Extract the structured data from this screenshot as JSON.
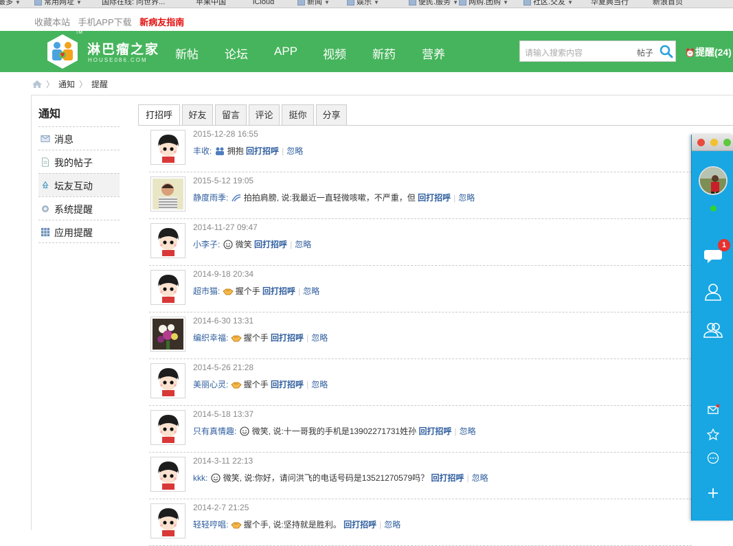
{
  "bookmarks": [
    {
      "label": "最多",
      "folder": false,
      "menu": true
    },
    {
      "label": "常用网址",
      "folder": true,
      "menu": true
    },
    {
      "label": "国际在线: 问世界...",
      "folder": false,
      "menu": false
    },
    {
      "label": "苹果中国",
      "folder": false,
      "menu": false
    },
    {
      "label": "iCloud",
      "folder": false,
      "menu": false
    },
    {
      "label": "新闻",
      "folder": true,
      "menu": true
    },
    {
      "label": "娱乐",
      "folder": true,
      "menu": true
    },
    {
      "label": "便民.服务",
      "folder": true,
      "menu": true
    },
    {
      "label": "网购.团购",
      "folder": true,
      "menu": true
    },
    {
      "label": "社区.交友",
      "folder": true,
      "menu": true
    },
    {
      "label": "华夏典当行",
      "folder": false,
      "menu": false
    },
    {
      "label": "新浪首页",
      "folder": false,
      "menu": false
    }
  ],
  "toplinks": {
    "favorite": "收藏本站",
    "app": "手机APP下载",
    "guide": "新病友指南"
  },
  "logo": {
    "name": "淋巴瘤之家",
    "sub": "HOUSE086.COM",
    "tm": "TM"
  },
  "nav": [
    "新帖",
    "论坛",
    "APP",
    "视频",
    "新药",
    "营养"
  ],
  "search": {
    "placeholder": "请输入搜索内容",
    "category": "帖子"
  },
  "remind": "提醒(24)",
  "breadcrumb": {
    "first": "通知",
    "second": "提醒"
  },
  "sidebar": {
    "title": "通知",
    "items": [
      {
        "label": "消息",
        "icon": "envelope-icon"
      },
      {
        "label": "我的帖子",
        "icon": "document-icon"
      },
      {
        "label": "坛友互动",
        "icon": "recycle-icon"
      },
      {
        "label": "系统提醒",
        "icon": "gear-icon"
      },
      {
        "label": "应用提醒",
        "icon": "grid-icon"
      }
    ]
  },
  "tabs": [
    "打招呼",
    "好友",
    "留言",
    "评论",
    "挺你",
    "分享"
  ],
  "actions": {
    "reply": "回打招呼",
    "ignore": "忽略"
  },
  "items": [
    {
      "date": "2015-12-28 16:55",
      "user": "丰收:",
      "action": "拥抱",
      "message": "",
      "emoji": "hug",
      "avatar": "cartoon"
    },
    {
      "date": "2015-5-12 19:05",
      "user": "静度雨季:",
      "action": "拍拍肩膀",
      "message": ", 说:我最近一直轻微咳嗽，不严重，但",
      "emoji": "pat",
      "avatar": "photo-woman"
    },
    {
      "date": "2014-11-27 09:47",
      "user": "小李子:",
      "action": "微笑",
      "message": "",
      "emoji": "smile",
      "avatar": "cartoon"
    },
    {
      "date": "2014-9-18 20:34",
      "user": "超市猫:",
      "action": "握个手",
      "message": "",
      "emoji": "handshake",
      "avatar": "cartoon"
    },
    {
      "date": "2014-6-30 13:31",
      "user": "编织幸福:",
      "action": "握个手",
      "message": "",
      "emoji": "handshake",
      "avatar": "photo-flowers"
    },
    {
      "date": "2014-5-26 21:28",
      "user": "美丽心灵:",
      "action": "握个手",
      "message": "",
      "emoji": "handshake",
      "avatar": "cartoon"
    },
    {
      "date": "2014-5-18 13:37",
      "user": "只有真情趣:",
      "action": "微笑",
      "message": ", 说:十一哥我的手机是13902271731姓孙",
      "emoji": "smile",
      "avatar": "cartoon"
    },
    {
      "date": "2014-3-11 22:13",
      "user": "kkk:",
      "action": "微笑",
      "message": ", 说:你好，请问洪飞的电话号码是13521270579吗？",
      "emoji": "smile",
      "avatar": "cartoon"
    },
    {
      "date": "2014-2-7 21:25",
      "user": "轻轻哼唱:",
      "action": "握个手",
      "message": ", 说:坚持就是胜利。",
      "emoji": "handshake",
      "avatar": "cartoon"
    }
  ],
  "panel": {
    "badge": "1"
  },
  "colors": {
    "header": "#46b45c",
    "link": "#2f5e9e",
    "panel": "#18a7e3",
    "guide": "#e30e0e"
  }
}
